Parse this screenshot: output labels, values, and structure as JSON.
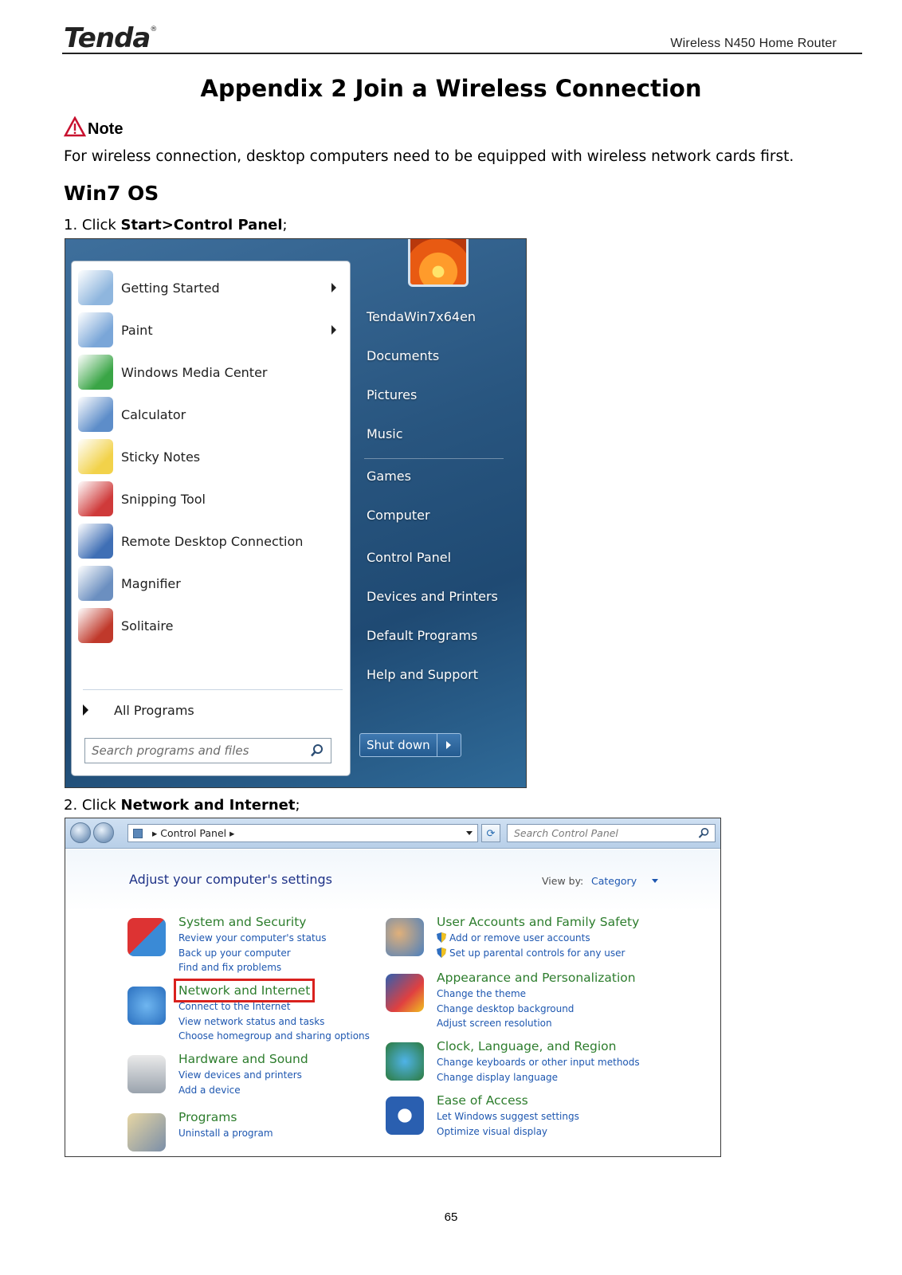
{
  "header": {
    "brand": "Tenda",
    "brand_mark": "®",
    "product": "Wireless N450 Home Router"
  },
  "title": "Appendix 2 Join a Wireless Connection",
  "note": {
    "label": "Note",
    "text": "For wireless connection, desktop computers need to be equipped with wireless network cards first."
  },
  "section": "Win7 OS",
  "step1": {
    "prefix": "1. Click ",
    "bold": "Start>Control Panel",
    "suffix": ";"
  },
  "step2": {
    "prefix": "2. Click ",
    "bold": "Network and Internet",
    "suffix": ";"
  },
  "start_menu": {
    "programs": [
      {
        "label": "Getting Started",
        "icon": "getting-started-icon",
        "arrow": true
      },
      {
        "label": "Paint",
        "icon": "paint-icon",
        "arrow": true
      },
      {
        "label": "Windows Media Center",
        "icon": "media-center-icon",
        "arrow": false
      },
      {
        "label": "Calculator",
        "icon": "calculator-icon",
        "arrow": false
      },
      {
        "label": "Sticky Notes",
        "icon": "sticky-notes-icon",
        "arrow": false
      },
      {
        "label": "Snipping Tool",
        "icon": "snipping-tool-icon",
        "arrow": false
      },
      {
        "label": "Remote Desktop Connection",
        "icon": "remote-desktop-icon",
        "arrow": false
      },
      {
        "label": "Magnifier",
        "icon": "magnifier-icon",
        "arrow": false
      },
      {
        "label": "Solitaire",
        "icon": "solitaire-icon",
        "arrow": false
      }
    ],
    "all_programs": "All Programs",
    "search_placeholder": "Search programs and files",
    "right_items": [
      "TendaWin7x64en",
      "Documents",
      "Pictures",
      "Music",
      "Games",
      "Computer",
      "Control Panel",
      "Devices and Printers",
      "Default Programs",
      "Help and Support"
    ],
    "shutdown": "Shut down"
  },
  "control_panel": {
    "address": "Control Panel",
    "search_placeholder": "Search Control Panel",
    "heading": "Adjust your computer's settings",
    "view_by_label": "View by:",
    "view_by_value": "Category",
    "groups_left": [
      {
        "title": "System and Security",
        "links": [
          "Review your computer's status",
          "Back up your computer",
          "Find and fix problems"
        ]
      },
      {
        "title": "Network and Internet",
        "links": [
          "Connect to the Internet",
          "View network status and tasks",
          "Choose homegroup and sharing options"
        ]
      },
      {
        "title": "Hardware and Sound",
        "links": [
          "View devices and printers",
          "Add a device"
        ]
      },
      {
        "title": "Programs",
        "links": [
          "Uninstall a program"
        ]
      }
    ],
    "groups_right": [
      {
        "title": "User Accounts and Family Safety",
        "links": [
          "Add or remove user accounts",
          "Set up parental controls for any user"
        ]
      },
      {
        "title": "Appearance and Personalization",
        "links": [
          "Change the theme",
          "Change desktop background",
          "Adjust screen resolution"
        ]
      },
      {
        "title": "Clock, Language, and Region",
        "links": [
          "Change keyboards or other input methods",
          "Change display language"
        ]
      },
      {
        "title": "Ease of Access",
        "links": [
          "Let Windows suggest settings",
          "Optimize visual display"
        ]
      }
    ]
  },
  "page_number": "65",
  "colors": {
    "note_red": "#c8102e",
    "cp_title_green": "#2d7d2d",
    "cp_link_blue": "#1e57b0",
    "highlight_red": "#d9211e"
  }
}
